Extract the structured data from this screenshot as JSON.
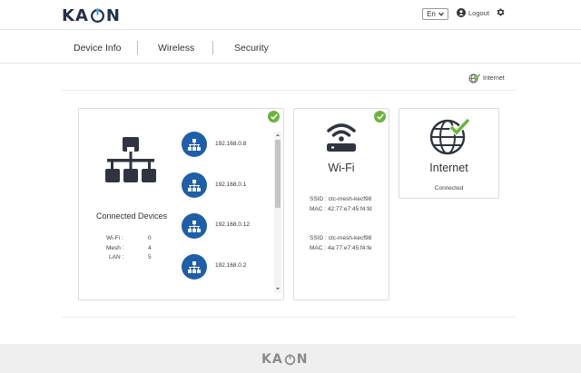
{
  "header": {
    "brand": {
      "pre": "KA",
      "post": "N"
    },
    "language": "En",
    "logout_label": "Logout"
  },
  "nav": {
    "tabs": [
      "Device Info",
      "Wireless",
      "Security"
    ]
  },
  "status": {
    "internet_label": "Internet"
  },
  "connected_devices": {
    "title": "Connected Devices",
    "counts": [
      {
        "label": "Wi-Fi :",
        "value": "0"
      },
      {
        "label": "Mesh :",
        "value": "4"
      },
      {
        "label": "LAN :",
        "value": "5"
      }
    ],
    "devices": [
      "192.168.0.8",
      "192.168.0.1",
      "192.168.0.12",
      "192.168.0.2"
    ]
  },
  "wifi": {
    "title": "Wi-Fi",
    "networks": [
      {
        "ssid": "SSID : ctc-mesh-kecf98",
        "mac": "MAC : 42:77:e7:45:f4:fd"
      },
      {
        "ssid": "SSID : ctc-mesh-kecf98",
        "mac": "MAC : 4a:77:e7:45:f4:fe"
      }
    ]
  },
  "internet": {
    "title": "Internet",
    "status": "Connected"
  },
  "footer": {
    "brand": {
      "pre": "KA",
      "post": "N"
    }
  },
  "colors": {
    "brand": "#23314a",
    "accent": "#1f5ea8",
    "ok": "#6cb33f"
  },
  "icons": [
    "kaon-o-logo",
    "chevron-down-icon",
    "user-icon",
    "gear-icon",
    "check-icon",
    "network-icon",
    "device-network-icon",
    "wifi-router-icon",
    "globe-icon"
  ]
}
